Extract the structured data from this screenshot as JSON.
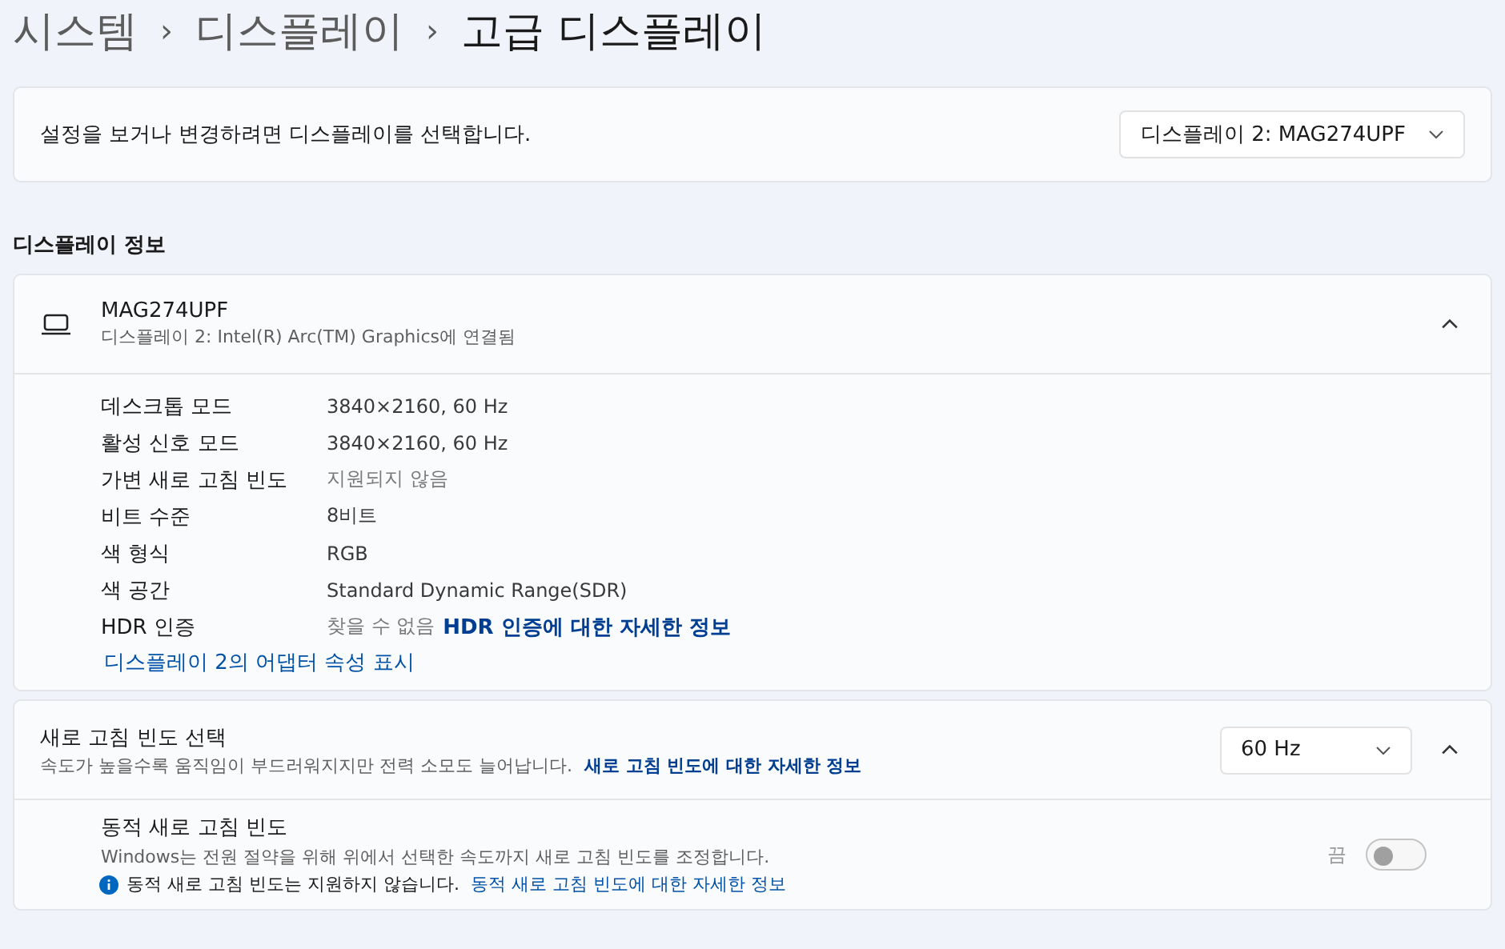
{
  "breadcrumb": [
    {
      "label": "시스템",
      "current": false
    },
    {
      "label": "디스플레이",
      "current": false
    },
    {
      "label": "고급 디스플레이",
      "current": true
    }
  ],
  "breadcrumb_separator": "›",
  "select_display": {
    "description": "설정을 보거나 변경하려면 디스플레이를 선택합니다.",
    "dropdown": "디스플레이 2: MAG274UPF"
  },
  "section_title": "디스플레이 정보",
  "display_info": {
    "name": "MAG274UPF",
    "subtitle": "디스플레이 2: Intel(R) Arc(TM) Graphics에 연결됨",
    "expanded": true,
    "rows": [
      {
        "label": "데스크톱 모드",
        "value": "3840×2160, 60 Hz",
        "muted": false
      },
      {
        "label": "활성 신호 모드",
        "value": "3840×2160, 60 Hz",
        "muted": false
      },
      {
        "label": "가변 새로 고침 빈도",
        "value": "지원되지 않음",
        "muted": true
      },
      {
        "label": "비트 수준",
        "value": "8비트",
        "muted": false
      },
      {
        "label": "색 형식",
        "value": "RGB",
        "muted": false
      },
      {
        "label": "색 공간",
        "value": "Standard Dynamic Range(SDR)",
        "muted": false
      },
      {
        "label": "HDR 인증",
        "value": "찾을 수 없음",
        "muted": true,
        "link": "HDR 인증에 대한 자세한 정보"
      }
    ],
    "adapter_link": "디스플레이 2의 어댑터 속성 표시"
  },
  "refresh_rate": {
    "title": "새로 고침 빈도 선택",
    "description": "속도가 높을수록 움직임이 부드러워지지만 전력 소모도 늘어납니다.",
    "link": "새로 고침 빈도에 대한 자세한 정보",
    "dropdown": "60 Hz",
    "expanded": true,
    "dynamic": {
      "title": "동적 새로 고침 빈도",
      "description": "Windows는 전원 절약을 위해 위에서 선택한 속도까지 새로 고침 빈도를 조정합니다.",
      "notice": "동적 새로 고침 빈도는 지원하지 않습니다.",
      "link": "동적 새로 고침 빈도에 대한 자세한 정보",
      "state_label": "끔",
      "on": false,
      "disabled": true
    }
  }
}
